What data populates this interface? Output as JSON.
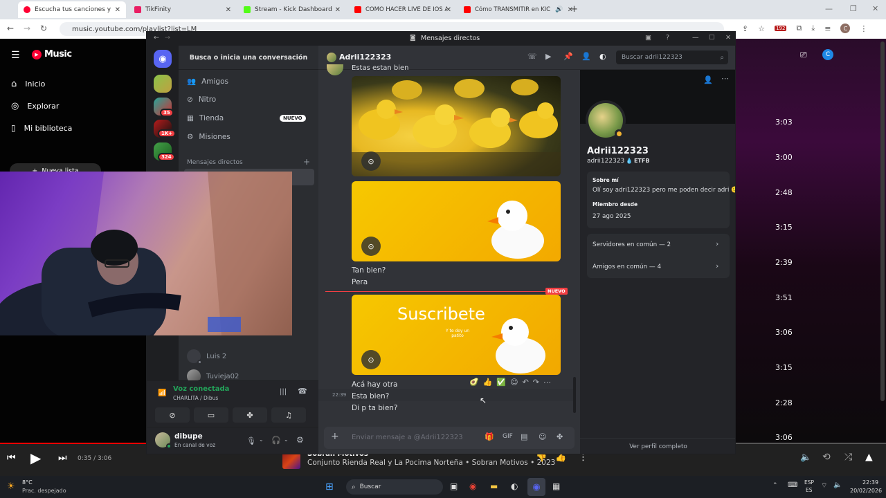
{
  "browser": {
    "tabs": [
      {
        "title": "Escucha tus canciones y álbum",
        "favicon_color": "#ff0033",
        "active": true
      },
      {
        "title": "TikFinity",
        "favicon_color": "#e91e63",
        "active": false
      },
      {
        "title": "Stream - Kick Dashboard",
        "favicon_color": "#53fc18",
        "active": false
      },
      {
        "title": "COMO HACER LIVE DE IOS A K",
        "favicon_color": "#ff0000",
        "active": false
      },
      {
        "title": "Cómo TRANSMITIR en KIC",
        "favicon_color": "#ff0000",
        "active": false
      }
    ],
    "url": "music.youtube.com/playlist?list=LM",
    "ext_badge": "192",
    "avatar_letter": "C"
  },
  "ytmusic": {
    "logo": "Music",
    "nav": [
      {
        "label": "Inicio",
        "icon": "home-icon"
      },
      {
        "label": "Explorar",
        "icon": "compass-icon"
      },
      {
        "label": "Mi biblioteca",
        "icon": "library-icon"
      }
    ],
    "new_playlist": "Nueva lista",
    "durations": [
      "3:03",
      "3:00",
      "2:48",
      "3:15",
      "2:39",
      "3:51",
      "3:06",
      "3:15",
      "2:28",
      "3:06"
    ],
    "cast_avatar": "C",
    "player": {
      "time": "0:35 / 3:06",
      "progress": 0.188,
      "title": "Sobran Motivos",
      "subtitle": "Conjunto Rienda Real y La Pocima Norteña • Sobran Motivos • 2023"
    }
  },
  "discord": {
    "window_title": "Mensajes directos",
    "search_placeholder": "Busca o inicia una conversación",
    "nav": [
      {
        "label": "Amigos",
        "icon": "friends-icon"
      },
      {
        "label": "Nitro",
        "icon": "nitro-icon"
      },
      {
        "label": "Tienda",
        "icon": "shop-icon",
        "badge": "NUEVO"
      },
      {
        "label": "Misiones",
        "icon": "quests-icon"
      }
    ],
    "dm_header": "Mensajes directos",
    "servers": [
      {
        "badge": "",
        "color": "#6a8f2f"
      },
      {
        "badge": "35",
        "color": "#3b9c5a"
      },
      {
        "badge": "1K+",
        "color": "#b81d1d"
      },
      {
        "badge": "324",
        "color": "#2e8b57"
      }
    ],
    "dms": [
      {
        "name": "Luis 2"
      },
      {
        "name": "Tuvieja02"
      }
    ],
    "voice": {
      "status": "Voz conectada",
      "channel": "CHARLITA / Dibus"
    },
    "user": {
      "name": "dibupe",
      "status": "En canal de voz"
    },
    "chat": {
      "recipient": "Adrii122323",
      "header_search": "Buscar adrii122323",
      "messages": [
        {
          "text": "Estas estan bien"
        },
        {
          "text": "Tan bien?"
        },
        {
          "text": "Pera"
        },
        {
          "text": "Acá hay otra"
        },
        {
          "time": "22:39",
          "text": "Esta bien?"
        },
        {
          "text": "Di p ta bien?"
        }
      ],
      "new_divider": "NUEVO",
      "subscribe_image_text": "Suscribete",
      "subscribe_image_sub": "Y te doy un patito",
      "input_placeholder": "Enviar mensaje a @Adrii122323"
    },
    "profile": {
      "display_name": "Adrii122323",
      "username": "adrii122323",
      "tag": "ETFB",
      "about_label": "Sobre mí",
      "about_text": "Olí soy adri122323 pero me poden decir adri 🙂",
      "member_since_label": "Miembro desde",
      "member_since": "27 ago 2025",
      "mutual_servers": "Servidores en común — 2",
      "mutual_friends": "Amigos en común — 4",
      "full_profile": "Ver perfil completo"
    }
  },
  "taskbar": {
    "weather_temp": "8°C",
    "weather_desc": "Prac. despejado",
    "search": "Buscar",
    "lang1": "ESP",
    "lang2": "ES",
    "time": "22:39",
    "date": "20/02/2026"
  }
}
